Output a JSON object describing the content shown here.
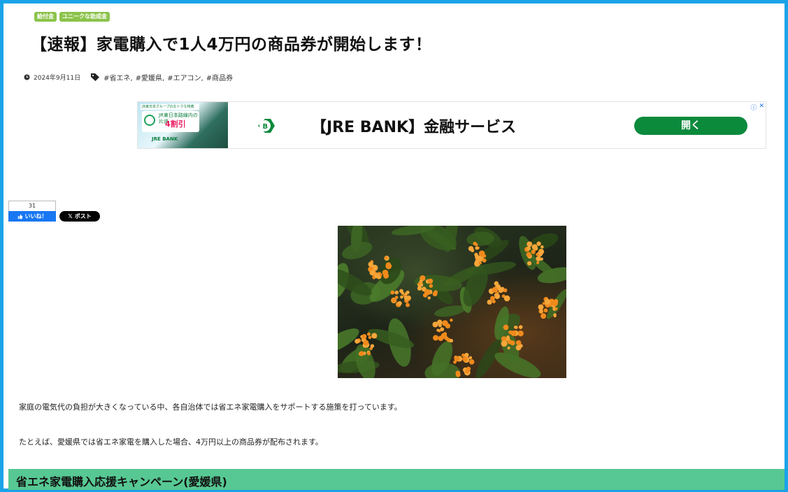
{
  "article": {
    "categories": [
      "給付金",
      "ユニークな助成金"
    ],
    "title": "【速報】家電購入で1人4万円の商品券が開始します！",
    "date": "2024年9月11日",
    "tags": [
      "#省エネ,",
      "#愛媛県,",
      "#エアコン,",
      "#商品券"
    ]
  },
  "ad": {
    "thumb_strip": "JR東日本グループのおトクな特典",
    "thumb_line1": "JR東日本路線内の",
    "thumb_line2": "片道",
    "thumb_discount": "4割引",
    "thumb_brand": "JRE BANK",
    "headline": "【JRE BANK】金融サービス",
    "button": "開く",
    "brand_color": "#0b8a3c"
  },
  "social": {
    "fb_count": "31",
    "fb_label": "いいね！",
    "x_label": "ポスト"
  },
  "body": {
    "paragraphs": [
      "家庭の電気代の負担が大きくなっている中、各自治体では省エネ家電購入をサポートする施策を打っています。",
      "たとえば、愛媛県では省エネ家電を購入した場合、4万円以上の商品券が配布されます。"
    ],
    "heading": "省エネ家電購入応援キャンペーン(愛媛県)"
  },
  "colors": {
    "frame": "#1aa3e8",
    "category_badge": "#8bc34a",
    "heading_bg": "#57c893"
  }
}
